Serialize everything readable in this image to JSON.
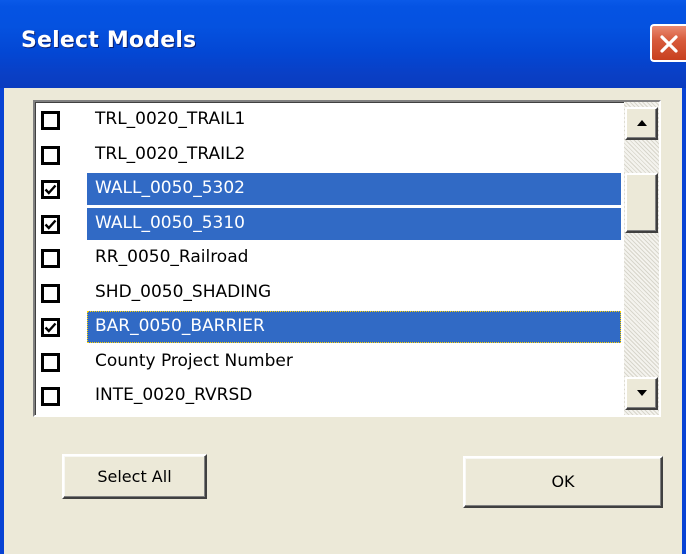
{
  "window": {
    "title": "Select Models",
    "close_icon": "close-icon"
  },
  "models_list": {
    "items": [
      {
        "label": "TRL_0020_TRAIL1",
        "checked": false,
        "selected": false
      },
      {
        "label": "TRL_0020_TRAIL2",
        "checked": false,
        "selected": false
      },
      {
        "label": "WALL_0050_5302",
        "checked": true,
        "selected": true
      },
      {
        "label": "WALL_0050_5310",
        "checked": true,
        "selected": true
      },
      {
        "label": "RR_0050_Railroad",
        "checked": false,
        "selected": false
      },
      {
        "label": "SHD_0050_SHADING",
        "checked": false,
        "selected": false
      },
      {
        "label": "BAR_0050_BARRIER",
        "checked": true,
        "selected": true
      },
      {
        "label": "County Project Number",
        "checked": false,
        "selected": false
      },
      {
        "label": "INTE_0020_RVRSD",
        "checked": false,
        "selected": false
      }
    ]
  },
  "buttons": {
    "select_all": "Select All",
    "ok": "OK"
  },
  "colors": {
    "title_bar": "#0553e3",
    "selection": "#316ac5",
    "dialog_face": "#ece9d8",
    "close_button": "#d85c3d"
  }
}
